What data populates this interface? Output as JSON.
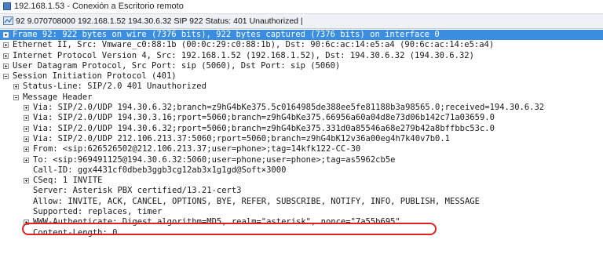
{
  "window": {
    "title": "192.168.1.53 - Conexión a Escritorio remoto"
  },
  "packet_summary": "92 9.070708000 192.168.1.52 194.30.6.32 SIP 922 Status: 401 Unauthorized |",
  "tree": [
    {
      "text": "Frame 92: 922 bytes on wire (7376 bits), 922 bytes captured (7376 bits) on interface 0",
      "expander": "plus",
      "indent": 0,
      "selected": true
    },
    {
      "text": "Ethernet II, Src: Vmware_c0:88:1b (00:0c:29:c0:88:1b), Dst: 90:6c:ac:14:e5:a4 (90:6c:ac:14:e5:a4)",
      "expander": "plus",
      "indent": 0
    },
    {
      "text": "Internet Protocol Version 4, Src: 192.168.1.52 (192.168.1.52), Dst: 194.30.6.32 (194.30.6.32)",
      "expander": "plus",
      "indent": 0
    },
    {
      "text": "User Datagram Protocol, Src Port: sip (5060), Dst Port: sip (5060)",
      "expander": "plus",
      "indent": 0
    },
    {
      "text": "Session Initiation Protocol (401)",
      "expander": "minus",
      "indent": 0
    },
    {
      "text": "Status-Line: SIP/2.0 401 Unauthorized",
      "expander": "plus",
      "indent": 1
    },
    {
      "text": "Message Header",
      "expander": "minus",
      "indent": 1
    },
    {
      "text": "Via: SIP/2.0/UDP 194.30.6.32;branch=z9hG4bKe375.5c0164985de388ee5fe81188b3a98565.0;received=194.30.6.32",
      "expander": "plus",
      "indent": 2
    },
    {
      "text": "Via: SIP/2.0/UDP 194.30.3.16;rport=5060;branch=z9hG4bKe375.66956a60a04d8e73d06b142c71a03659.0",
      "expander": "plus",
      "indent": 2
    },
    {
      "text": "Via: SIP/2.0/UDP 194.30.6.32;rport=5060;branch=z9hG4bKe375.331d0a85546a68e279b42a8bffbbc53c.0",
      "expander": "plus",
      "indent": 2
    },
    {
      "text": "Via: SIP/2.0/UDP 212.106.213.37:5060;rport=5060;branch=z9hG4bK12v36a00eg4h7k40v7b0.1",
      "expander": "plus",
      "indent": 2
    },
    {
      "text": "From: <sip:626526502@212.106.213.37;user=phone>;tag=14kfk122-CC-30",
      "expander": "plus",
      "indent": 2
    },
    {
      "text": "To: <sip:969491125@194.30.6.32:5060;user=phone;user=phone>;tag=as5962cb5e",
      "expander": "plus",
      "indent": 2
    },
    {
      "text": "Call-ID: ggx4431cf0dbeb3ggb3cg12ab3x1g1gd@Soft×3000",
      "expander": "none",
      "indent": 2
    },
    {
      "text": "CSeq: 1 INVITE",
      "expander": "plus",
      "indent": 2
    },
    {
      "text": "Server: Asterisk PBX certified/13.21-cert3",
      "expander": "none",
      "indent": 2
    },
    {
      "text": "Allow: INVITE, ACK, CANCEL, OPTIONS, BYE, REFER, SUBSCRIBE, NOTIFY, INFO, PUBLISH, MESSAGE",
      "expander": "none",
      "indent": 2
    },
    {
      "text": "Supported: replaces, timer",
      "expander": "none",
      "indent": 2
    },
    {
      "text": "WWW-Authenticate: Digest algorithm=MD5, realm=\"asterisk\", nonce=\"7a55b695\"",
      "expander": "plus",
      "indent": 2
    },
    {
      "text": "Content-Length: 0",
      "expander": "none",
      "indent": 2
    }
  ],
  "colors": {
    "selection": "#3b8de0",
    "annotation": "#e02020"
  }
}
